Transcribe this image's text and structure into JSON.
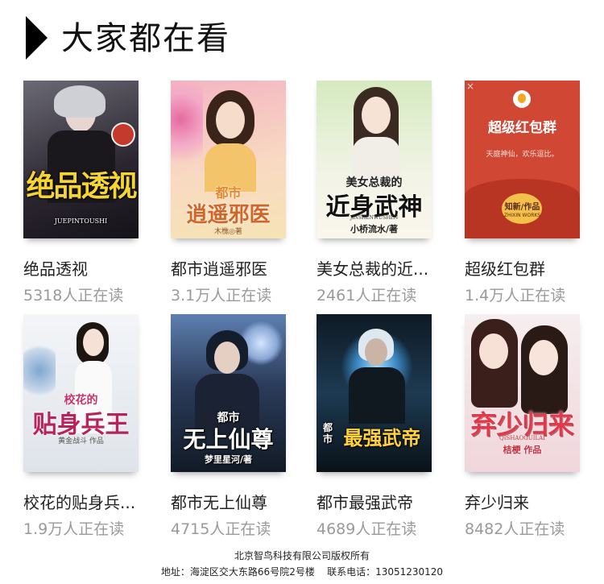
{
  "section": {
    "title": "大家都在看"
  },
  "books": [
    {
      "title": "绝品透视",
      "readers": "5318人正在读",
      "cover_text": "绝品透视",
      "cover_sub": "JUEPINTOUSHI",
      "colors": [
        "#4c4a52",
        "#1e1b24"
      ],
      "accent": "#f6d531"
    },
    {
      "title": "都市逍遥邪医",
      "readers": "3.1万人正在读",
      "cover_text": "逍遥邪医",
      "cover_top": "都市",
      "cover_author": "木樵◎著",
      "colors": [
        "#f7c2c8",
        "#f6dcae"
      ],
      "accent": "#e8872a"
    },
    {
      "title": "美女总裁的近...",
      "readers": "2461人正在读",
      "cover_text": "近身武神",
      "cover_top": "美女总裁的",
      "cover_sub": "JINSHENWUSHEN",
      "cover_author": "小桥流水/著",
      "colors": [
        "#dfeec9",
        "#f6f2e4"
      ],
      "accent": "#222222"
    },
    {
      "title": "超级红包群",
      "readers": "1.4万人正在读",
      "cover_text": "超级红包群",
      "cover_sub": "天庭神仙，欢乐逗比。",
      "cover_author": "知新/作品",
      "cover_brand": "ZHIXIN WORKS",
      "colors": [
        "#d44a36",
        "#c23b2a"
      ],
      "accent": "#f5c04a"
    },
    {
      "title": "校花的贴身兵...",
      "readers": "1.9万人正在读",
      "cover_text": "贴身兵王",
      "cover_top": "校花的",
      "cover_author": "黄金战斗 作品",
      "colors": [
        "#eef2f6",
        "#d4dae3"
      ],
      "accent": "#c9326a"
    },
    {
      "title": "都市无上仙尊",
      "readers": "4715人正在读",
      "cover_text": "无上仙尊",
      "cover_top": "都市",
      "cover_author": "梦里星河/著",
      "colors": [
        "#2d3f5e",
        "#15202f"
      ],
      "accent": "#ffffff"
    },
    {
      "title": "都市最强武帝",
      "readers": "4689人正在读",
      "cover_text": "最强武帝",
      "cover_top": "都市",
      "colors": [
        "#1d3a52",
        "#0a1520"
      ],
      "accent": "#ffd23a"
    },
    {
      "title": "弃少归来",
      "readers": "8482人正在读",
      "cover_text": "弃少归来",
      "cover_sub": "QISHAOGUILAI",
      "cover_author": "桔梗 作品",
      "colors": [
        "#f7e7e9",
        "#eed0d4"
      ],
      "accent": "#e2394a"
    }
  ],
  "footer": {
    "company": "北京智鸟科技有限公司版权所有",
    "address": "地址：海淀区交大东路66号院2号楼    联系电话：13051230120"
  }
}
